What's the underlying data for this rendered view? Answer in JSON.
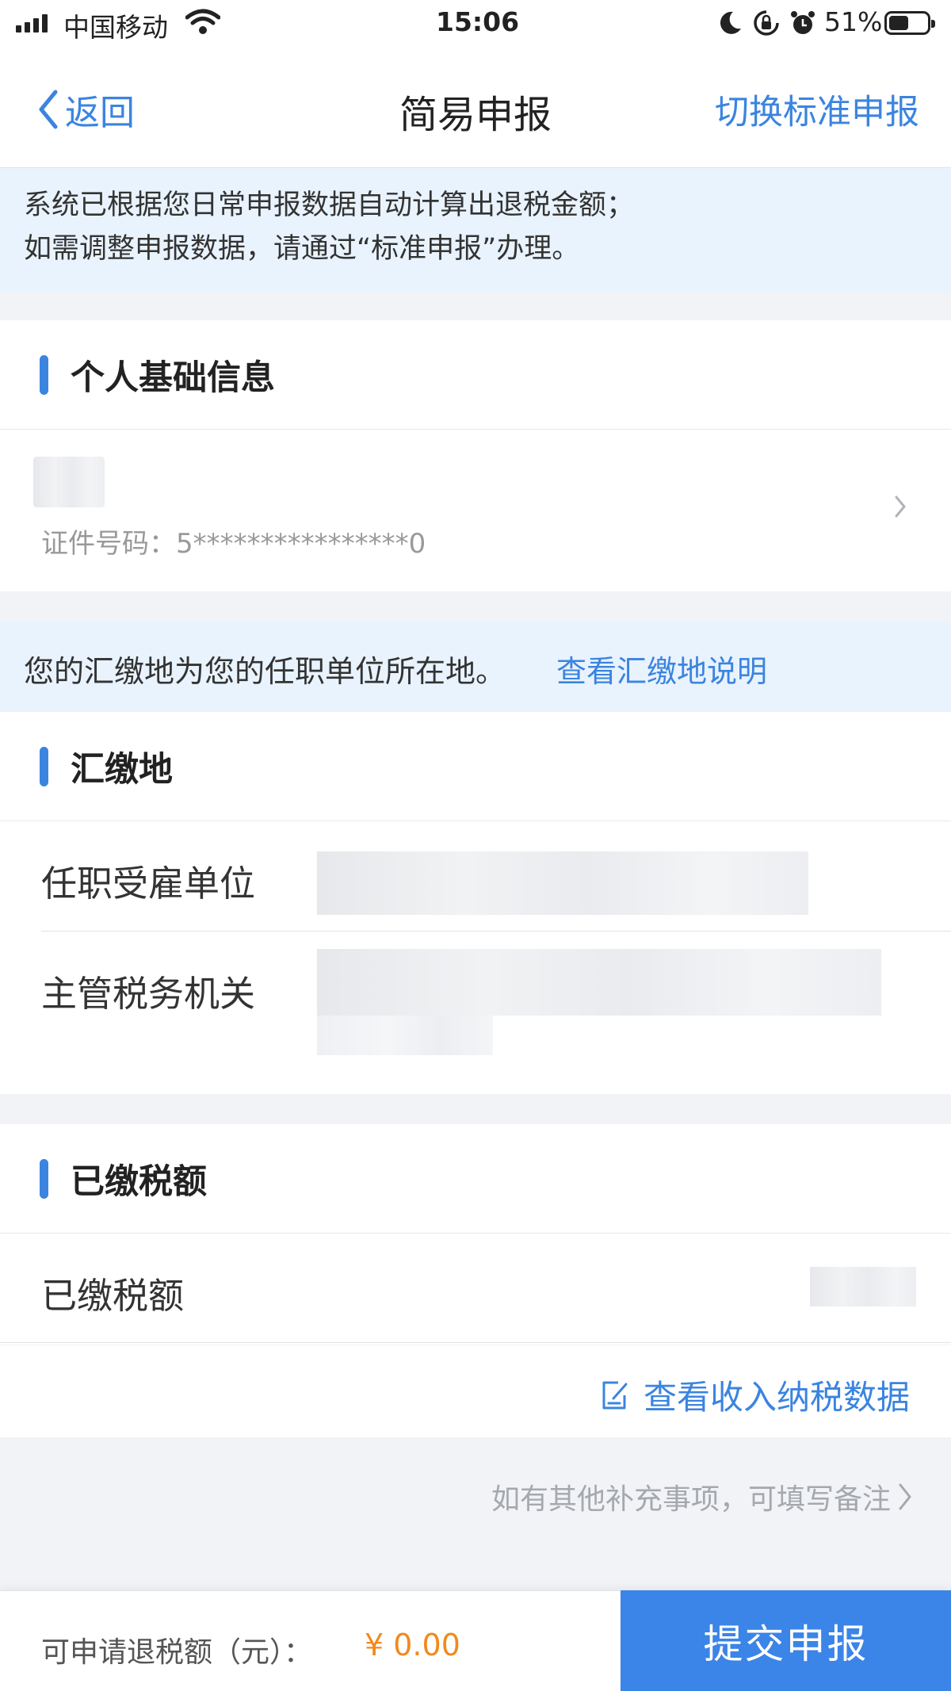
{
  "status_bar": {
    "carrier": "中国移动",
    "time": "15:06",
    "battery": "51%",
    "battery_level": 0.51,
    "icons": [
      "signal-icon",
      "wifi-icon",
      "moon-icon",
      "rotation-lock-icon",
      "alarm-icon",
      "battery-icon"
    ]
  },
  "nav": {
    "back_label": "返回",
    "title": "简易申报",
    "switch_label": "切换标准申报"
  },
  "notice": {
    "line1": "系统已根据您日常申报数据自动计算出退税金额；",
    "line2": "如需调整申报数据，请通过“标准申报”办理。"
  },
  "personal": {
    "section_title": "个人基础信息",
    "id_line": "证件号码：5****************0"
  },
  "location_tip": {
    "text": "您的汇缴地为您的任职单位所在地。",
    "link": "查看汇缴地说明"
  },
  "remit": {
    "section_title": "汇缴地",
    "employer_label": "任职受雇单位",
    "tax_authority_label": "主管税务机关"
  },
  "paid": {
    "section_title": "已缴税额",
    "row_label": "已缴税额"
  },
  "links": {
    "view_income": "查看收入纳税数据",
    "remark": "如有其他补充事项，可填写备注"
  },
  "footer": {
    "refund_label": "可申请退税额（元）：",
    "refund_value": "¥ 0.00",
    "submit_label": "提交申报"
  },
  "colors": {
    "accent": "#3b84e0",
    "submit_bg": "#3b84e8",
    "refund": "#f08a1e",
    "notice_bg": "#e9f3fd"
  }
}
